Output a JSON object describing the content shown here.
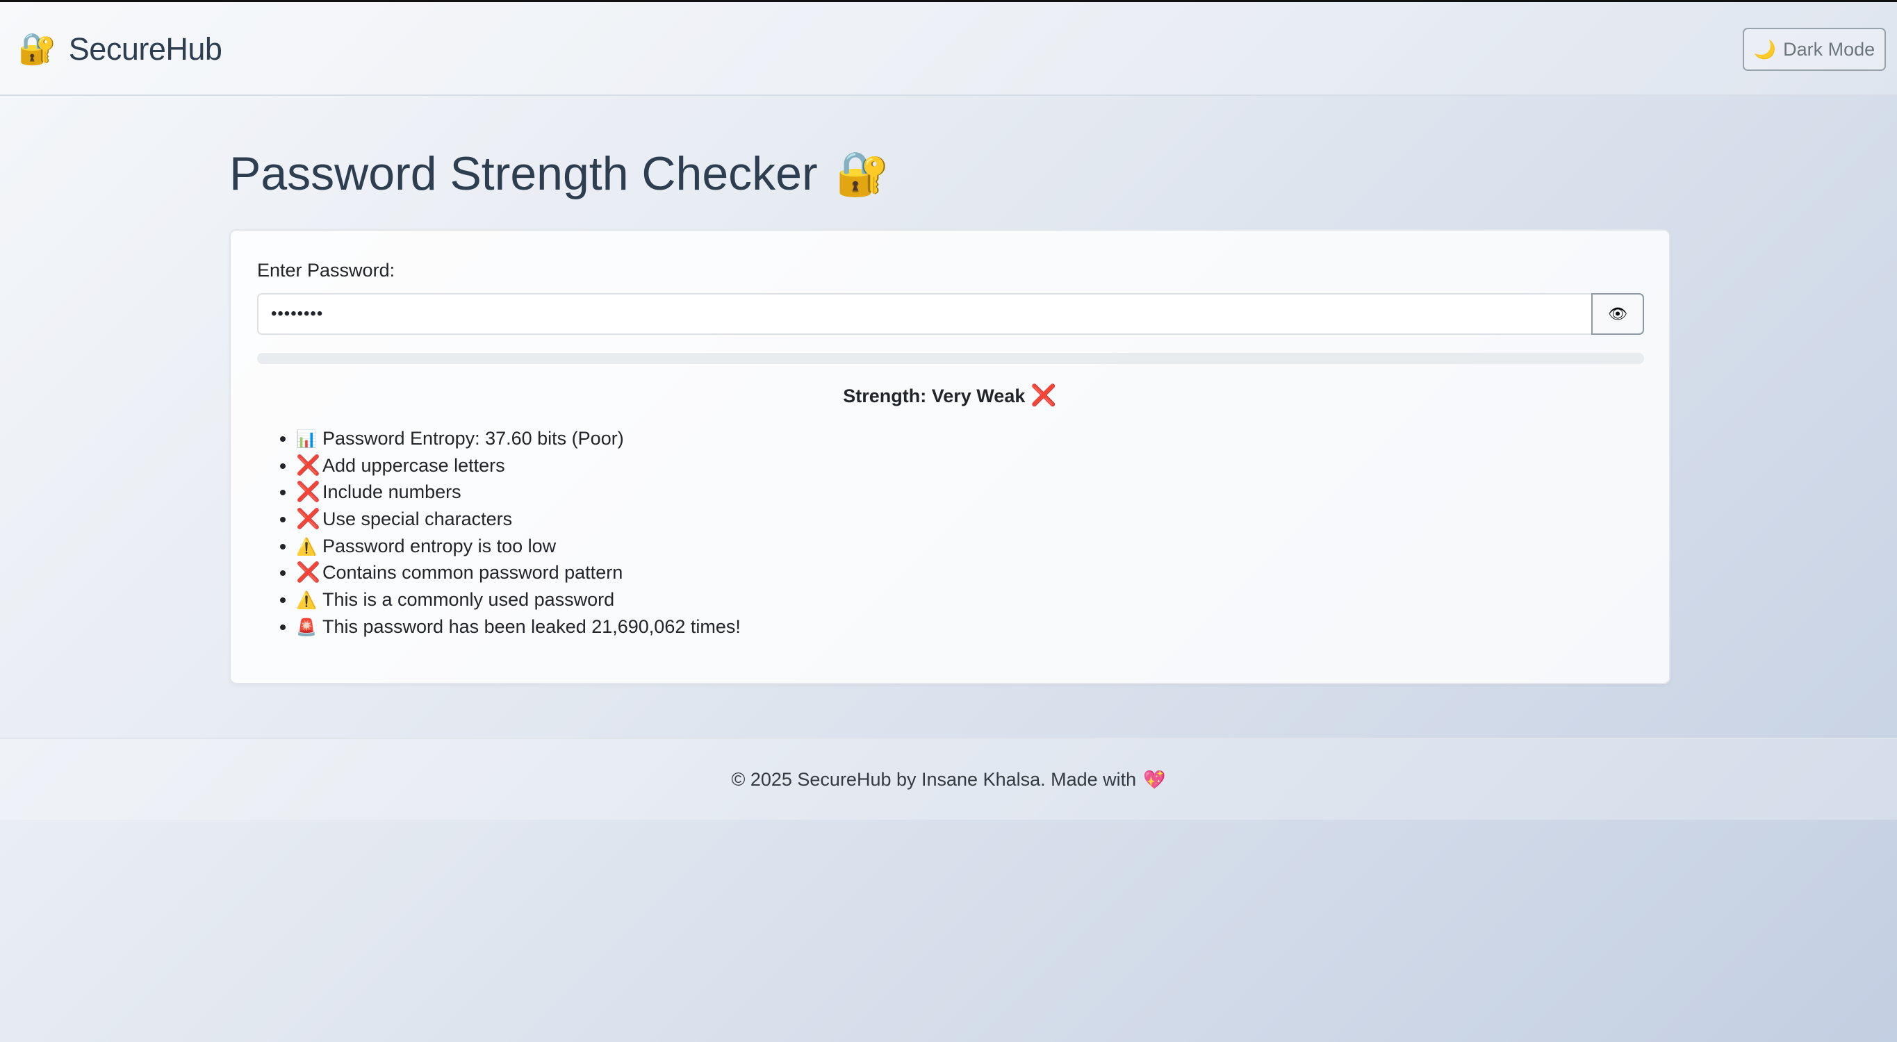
{
  "navbar": {
    "brand_icon": "🔐",
    "brand": "SecureHub",
    "dark_mode_icon": "🌙",
    "dark_mode_label": "Dark Mode"
  },
  "page": {
    "title": "Password Strength Checker",
    "title_icon": "🔐"
  },
  "form": {
    "label": "Enter Password:",
    "password_value": "password",
    "toggle_icon": "👁",
    "strength_progress_percent": 0,
    "strength_text": "Strength: Very Weak",
    "strength_icon": "❌"
  },
  "feedback": [
    {
      "icon": "📊",
      "icon_type": "chart",
      "text": "Password Entropy: 37.60 bits (Poor)"
    },
    {
      "icon": "❌",
      "icon_type": "red",
      "text": "Add uppercase letters"
    },
    {
      "icon": "❌",
      "icon_type": "red",
      "text": "Include numbers"
    },
    {
      "icon": "❌",
      "icon_type": "red",
      "text": "Use special characters"
    },
    {
      "icon": "⚠️",
      "icon_type": "warn",
      "text": "Password entropy is too low"
    },
    {
      "icon": "❌",
      "icon_type": "red",
      "text": "Contains common password pattern"
    },
    {
      "icon": "⚠️",
      "icon_type": "warn",
      "text": "This is a commonly used password"
    },
    {
      "icon": "🚨",
      "icon_type": "siren",
      "text": "This password has been leaked 21,690,062 times!"
    }
  ],
  "footer": {
    "text": "© 2025 SecureHub by Insane Khalsa. Made with",
    "heart_icon": "💖"
  },
  "colors": {
    "text": "#2c3e50",
    "danger": "#dc3545",
    "cross": "#e8335a"
  }
}
